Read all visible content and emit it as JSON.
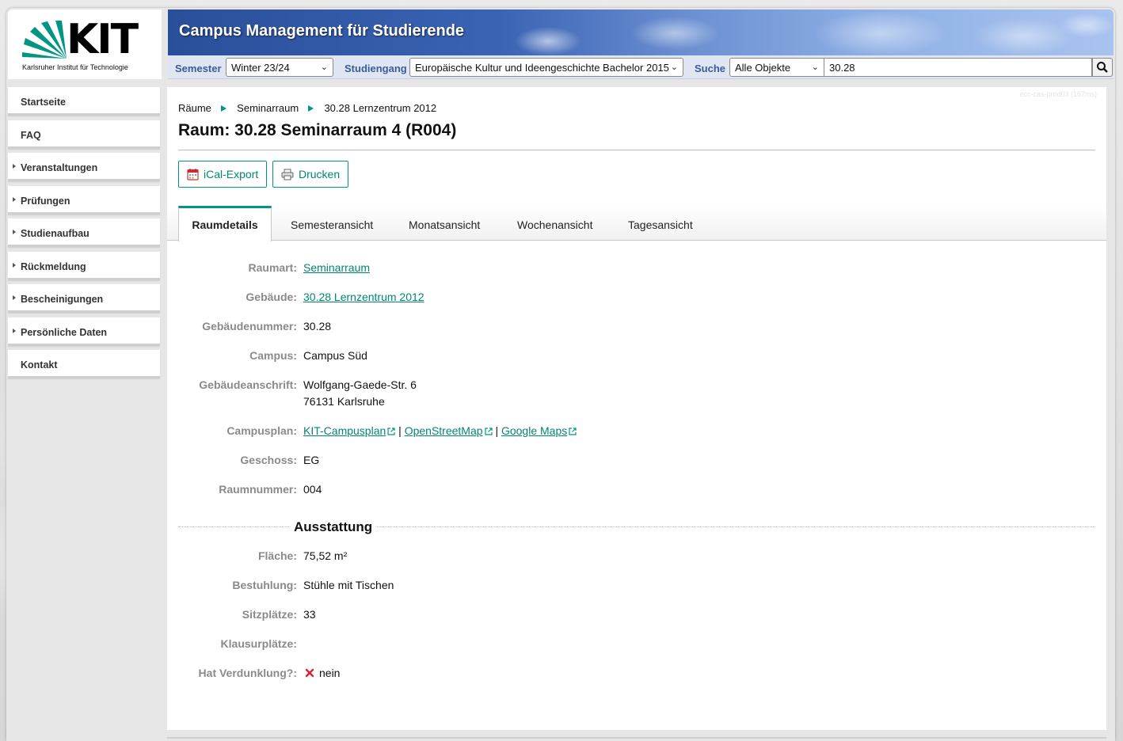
{
  "logo": {
    "word": "KIT",
    "subtitle": "Karlsruher Institut für Technologie"
  },
  "header": {
    "title": "Campus Management für Studierende"
  },
  "filters": {
    "semester_label": "Semester",
    "semester_value": "Winter 23/24",
    "studiengang_label": "Studiengang",
    "studiengang_value": "Europäische Kultur und Ideengeschichte Bachelor 2015",
    "suche_label": "Suche",
    "suche_scope": "Alle Objekte",
    "suche_query": "30.28"
  },
  "sidebar": {
    "items": [
      {
        "label": "Startseite",
        "expandable": false
      },
      {
        "label": "FAQ",
        "expandable": false
      },
      {
        "label": "Veranstaltungen",
        "expandable": true
      },
      {
        "label": "Prüfungen",
        "expandable": true
      },
      {
        "label": "Studienaufbau",
        "expandable": true
      },
      {
        "label": "Rückmeldung",
        "expandable": true
      },
      {
        "label": "Bescheinigungen",
        "expandable": true
      },
      {
        "label": "Persönliche Daten",
        "expandable": true
      },
      {
        "label": "Kontakt",
        "expandable": false
      }
    ]
  },
  "build_id": "ecc-cas-prod03 (167ms)",
  "breadcrumb": [
    "Räume",
    "Seminarraum",
    "30.28 Lernzentrum 2012"
  ],
  "page_title": "Raum: 30.28 Seminarraum 4 (R004)",
  "actions": {
    "ical": "iCal-Export",
    "print": "Drucken"
  },
  "tabs": [
    "Raumdetails",
    "Semesteransicht",
    "Monatsansicht",
    "Wochenansicht",
    "Tagesansicht"
  ],
  "active_tab": "Raumdetails",
  "details": {
    "raumart_label": "Raumart:",
    "raumart": "Seminarraum",
    "gebaeude_label": "Gebäude:",
    "gebaeude": "30.28 Lernzentrum 2012",
    "gebaeudenummer_label": "Gebäudenummer:",
    "gebaeudenummer": "30.28",
    "campus_label": "Campus:",
    "campus": "Campus Süd",
    "anschrift_label": "Gebäudeanschrift:",
    "anschrift_line1": "Wolfgang-Gaede-Str. 6",
    "anschrift_line2": "76131 Karlsruhe",
    "campusplan_label": "Campusplan:",
    "campusplan_kit": "KIT-Campusplan",
    "campusplan_osm": "OpenStreetMap",
    "campusplan_google": "Google Maps",
    "geschoss_label": "Geschoss:",
    "geschoss": "EG",
    "raumnummer_label": "Raumnummer:",
    "raumnummer": "004"
  },
  "ausstattung": {
    "title": "Ausstattung",
    "flaeche_label": "Fläche:",
    "flaeche": "75,52 m²",
    "bestuhlung_label": "Bestuhlung:",
    "bestuhlung": "Stühle mit Tischen",
    "sitzplaetze_label": "Sitzplätze:",
    "sitzplaetze": "33",
    "klausurplaetze_label": "Klausurplätze:",
    "klausurplaetze": "",
    "verdunklung_label": "Hat Verdunklung?:",
    "verdunklung": "nein"
  },
  "colors": {
    "accent": "#009682",
    "header_blue": "#3a63b4",
    "label_grey": "#8a8a8a",
    "no_red": "#d9232e"
  }
}
